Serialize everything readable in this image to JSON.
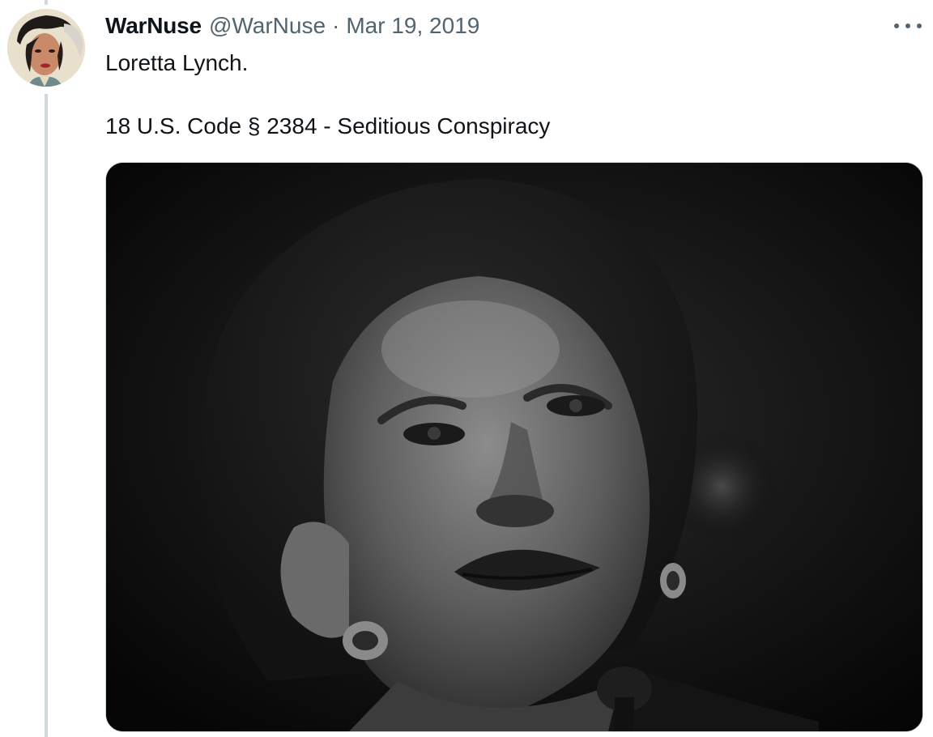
{
  "tweet": {
    "display_name": "WarNuse",
    "handle": "@WarNuse",
    "separator": "·",
    "date": "Mar 19, 2019",
    "lines": [
      "Loretta Lynch.",
      "18 U.S. Code § 2384 - Seditious Conspiracy"
    ],
    "more_icon": "more-horizontal-icon",
    "media_description_icon": "photo"
  },
  "colors": {
    "primary_text": "#0f1419",
    "secondary_text": "#536471",
    "thread_line": "#cfd9de",
    "media_border": "#cfd9de"
  }
}
